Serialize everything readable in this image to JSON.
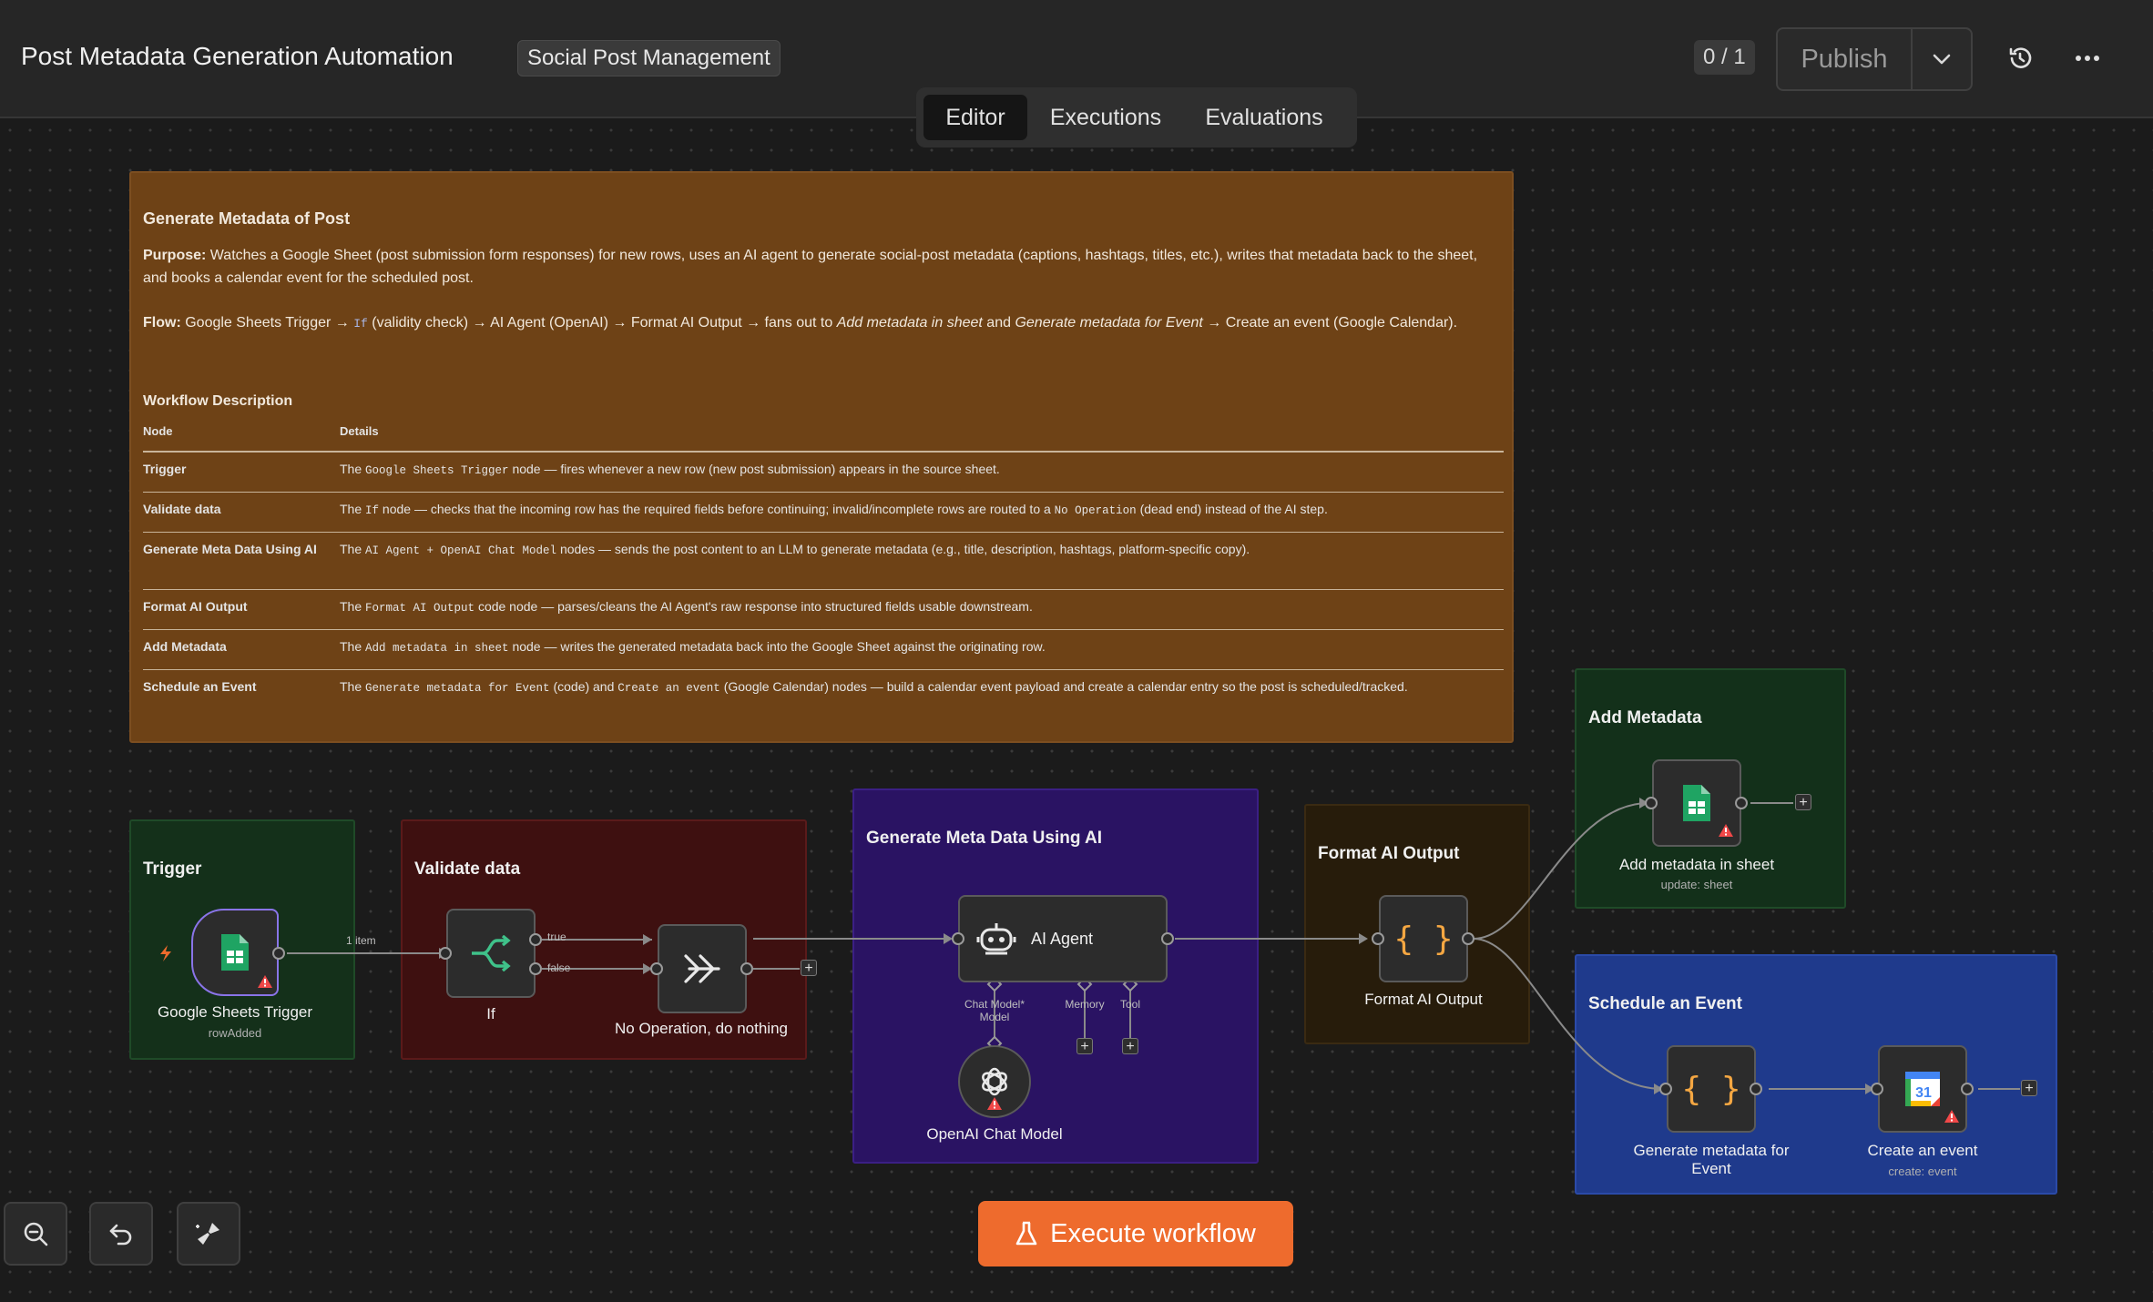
{
  "header": {
    "title": "Post Metadata Generation Automation",
    "tag": "Social Post Management",
    "counter": "0 / 1",
    "publish_label": "Publish",
    "history_icon": "history-icon",
    "more_icon": "more-horizontal-icon"
  },
  "tabs": [
    "Editor",
    "Executions",
    "Evaluations"
  ],
  "active_tab": "Editor",
  "note": {
    "title": "Generate Metadata of Post",
    "purpose_label": "Purpose:",
    "purpose_text": "Watches a Google Sheet (post submission form responses) for new rows, uses an AI agent to generate social-post metadata (captions, hashtags, titles, etc.), writes that metadata back to the sheet, and books a calendar event for the scheduled post.",
    "flow_label": "Flow:",
    "flow_part1": "Google Sheets Trigger →",
    "flow_code": "If",
    "flow_part2": "(validity check) → AI Agent (OpenAI) → Format AI Output → fans out to",
    "flow_em1": "Add metadata in sheet",
    "flow_and": "and",
    "flow_em2": "Generate metadata for Event",
    "flow_part3": "→ Create an event (Google Calendar).",
    "section_title": "Workflow Description",
    "col_node": "Node",
    "col_details": "Details",
    "rows": [
      {
        "node": "Trigger",
        "pre": "The",
        "code1": "Google Sheets Trigger",
        "mid": "node — fires whenever a new row (new post submission) appears in the source sheet.",
        "code2": "",
        "post": ""
      },
      {
        "node": "Validate data",
        "pre": "The",
        "code1": "If",
        "mid": "node — checks that the incoming row has the required fields before continuing; invalid/incomplete rows are routed to a",
        "code2": "No Operation",
        "post": "(dead end) instead of the AI step."
      },
      {
        "node": "Generate Meta Data Using AI",
        "pre": "The",
        "code1": "AI Agent + OpenAI Chat Model",
        "mid": "nodes — sends the post content to an LLM to generate metadata (e.g., title, description, hashtags, platform-specific copy).",
        "code2": "",
        "post": ""
      },
      {
        "node": "Format AI Output",
        "pre": "The",
        "code1": "Format AI Output",
        "mid": "code node — parses/cleans the AI Agent's raw response into structured fields usable downstream.",
        "code2": "",
        "post": ""
      },
      {
        "node": "Add Metadata",
        "pre": "The",
        "code1": "Add metadata in sheet",
        "mid": "node — writes the generated metadata back into the Google Sheet against the originating row.",
        "code2": "",
        "post": ""
      },
      {
        "node": "Schedule an Event",
        "pre": "The",
        "code1": "Generate metadata for Event",
        "mid": "(code) and",
        "code2": "Create an event",
        "post": "(Google Calendar) nodes — build a calendar event payload and create a calendar entry so the post is scheduled/tracked."
      }
    ]
  },
  "groups": {
    "trigger": "Trigger",
    "validate": "Validate data",
    "generate": "Generate Meta Data Using AI",
    "format": "Format AI Output",
    "add_metadata": "Add Metadata",
    "schedule": "Schedule an Event"
  },
  "nodes": {
    "sheets_trigger": {
      "label": "Google Sheets Trigger",
      "sub": "rowAdded"
    },
    "if": {
      "label": "If"
    },
    "noop": {
      "label": "No Operation, do nothing"
    },
    "ai_agent": {
      "label": "AI Agent"
    },
    "openai": {
      "label": "OpenAI Chat Model"
    },
    "format": {
      "label": "Format AI Output"
    },
    "add_sheet": {
      "label": "Add metadata in sheet",
      "sub": "update: sheet"
    },
    "gen_event": {
      "label": "Generate metadata for Event"
    },
    "create_event": {
      "label": "Create an event",
      "sub": "create: event",
      "calendar_day": "31"
    }
  },
  "edge_labels": {
    "items": "1 item",
    "true": "true",
    "false": "false",
    "chat_model": "Chat Model*",
    "model": "Model",
    "memory": "Memory",
    "tool": "Tool"
  },
  "footer": {
    "execute_label": "Execute workflow"
  },
  "colors": {
    "accent": "#ee6b2d",
    "note": "#6e4216",
    "trigger_group": "#14301a",
    "validate_group": "#3e1010",
    "generate_group": "#2a1363",
    "format_group": "#271c0b",
    "schedule_group": "#1f3a8c",
    "warning": "#f04848"
  }
}
